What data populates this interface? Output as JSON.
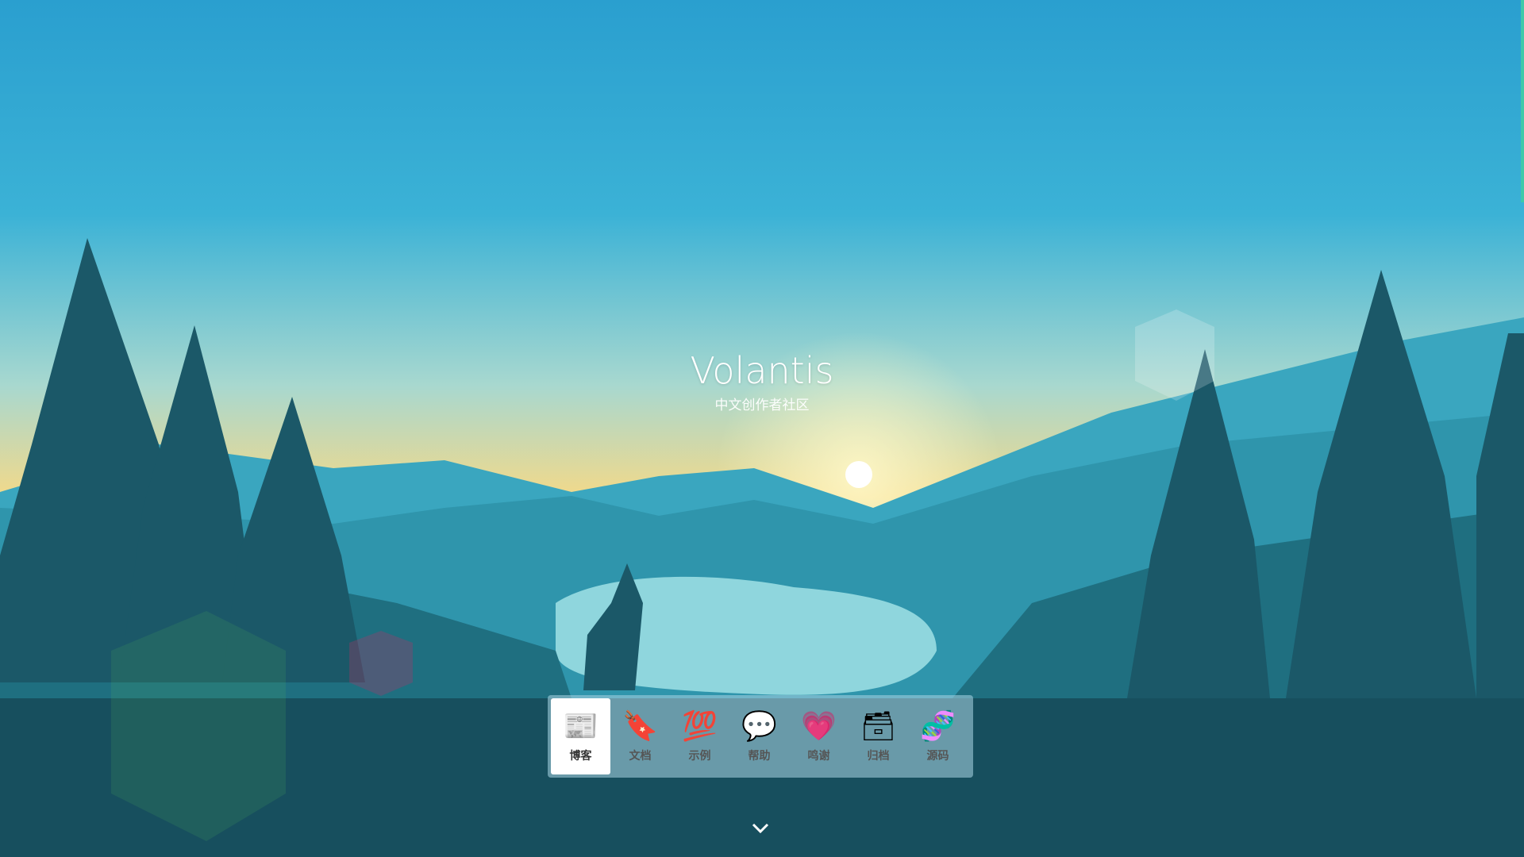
{
  "header": {
    "title": "Volantis",
    "subtitle": "中文创作者社区"
  },
  "nav": {
    "items": [
      {
        "label": "博客",
        "icon": "newspaper-icon",
        "glyph": "📰",
        "active": true
      },
      {
        "label": "文档",
        "icon": "bookmark-book-icon",
        "glyph": "🔖",
        "active": false
      },
      {
        "label": "示例",
        "icon": "hundred-points-icon",
        "glyph": "💯",
        "active": false
      },
      {
        "label": "帮助",
        "icon": "speech-bubble-icon",
        "glyph": "💬",
        "active": false
      },
      {
        "label": "鸣谢",
        "icon": "heart-icon",
        "glyph": "💗",
        "active": false
      },
      {
        "label": "归档",
        "icon": "card-file-box-icon",
        "glyph": "🗃",
        "active": false
      },
      {
        "label": "源码",
        "icon": "dna-icon",
        "glyph": "🧬",
        "active": false
      }
    ]
  },
  "colors": {
    "sky_top": "#2a9fcf",
    "horizon": "#f2d98a",
    "forest": "#174f5e",
    "accent": "#3fc9a9"
  }
}
